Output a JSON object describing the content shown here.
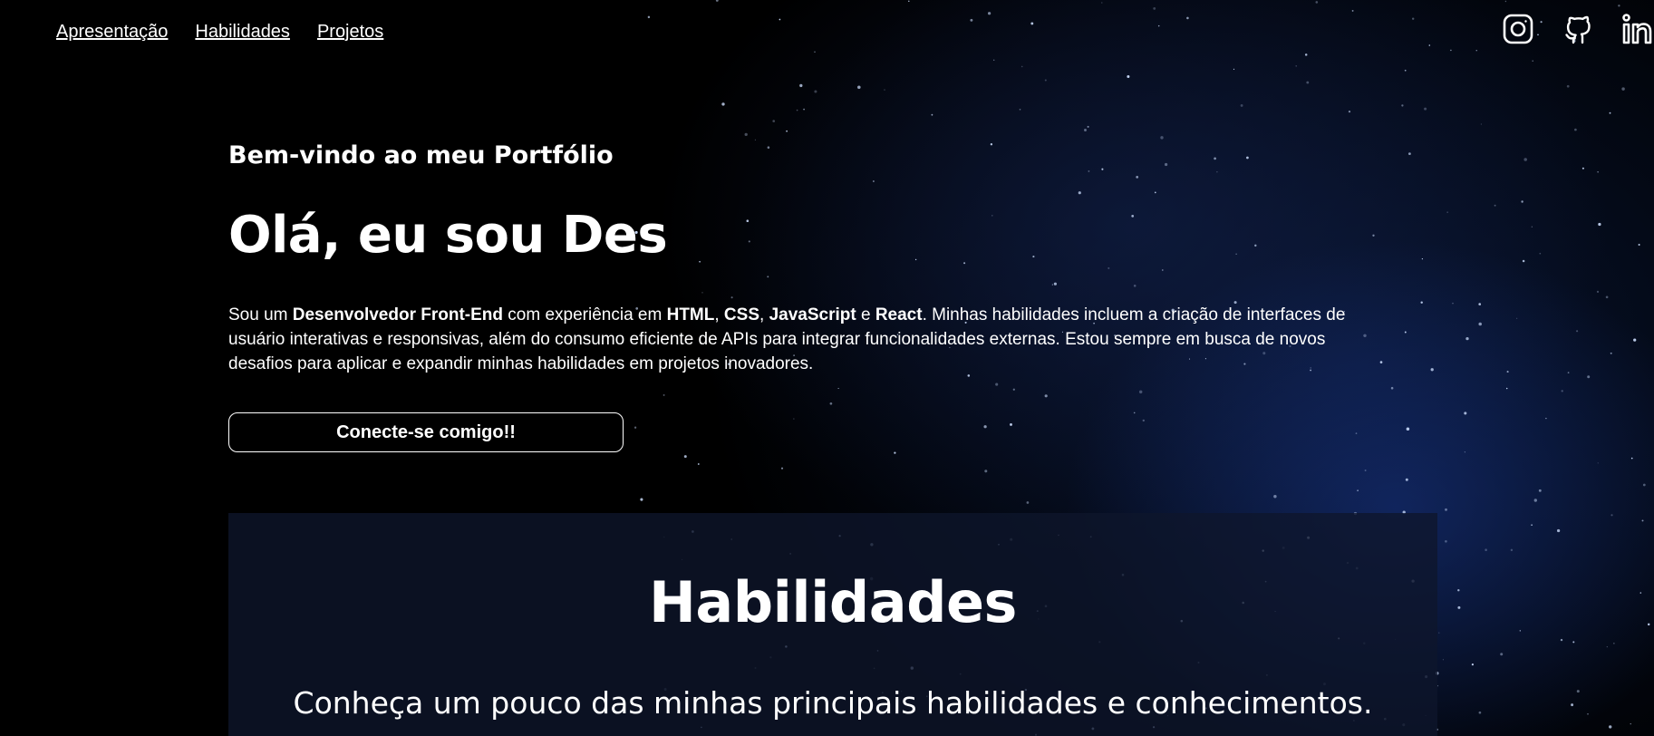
{
  "nav": {
    "items": [
      {
        "label": "Apresentação"
      },
      {
        "label": "Habilidades"
      },
      {
        "label": "Projetos"
      }
    ]
  },
  "social": {
    "icons": [
      "instagram-icon",
      "github-icon",
      "linkedin-icon"
    ]
  },
  "hero": {
    "welcome": "Bem-vindo ao meu Portfólio",
    "title": "Olá, eu sou Des",
    "intro": {
      "p1": "Sou um ",
      "b1": "Desenvolvedor Front-End",
      "p2": " com experiência em ",
      "b2": "HTML",
      "p3": ", ",
      "b3": "CSS",
      "p4": ", ",
      "b4": "JavaScript",
      "p5": " e ",
      "b5": "React",
      "p6": ". Minhas habilidades incluem a criação de interfaces de usuário interativas e responsivas, além do consumo eficiente de APIs para integrar funcionalidades externas. Estou sempre em busca de novos desafios para aplicar e expandir minhas habilidades em projetos inovadores."
    },
    "cta_label": "Conecte-se comigo!!"
  },
  "skills": {
    "title": "Habilidades",
    "subtitle": "Conheça um pouco das minhas principais habilidades e conhecimentos."
  },
  "colors": {
    "background": "#000000",
    "text": "#ffffff",
    "skills_panel": "#0e162c"
  }
}
